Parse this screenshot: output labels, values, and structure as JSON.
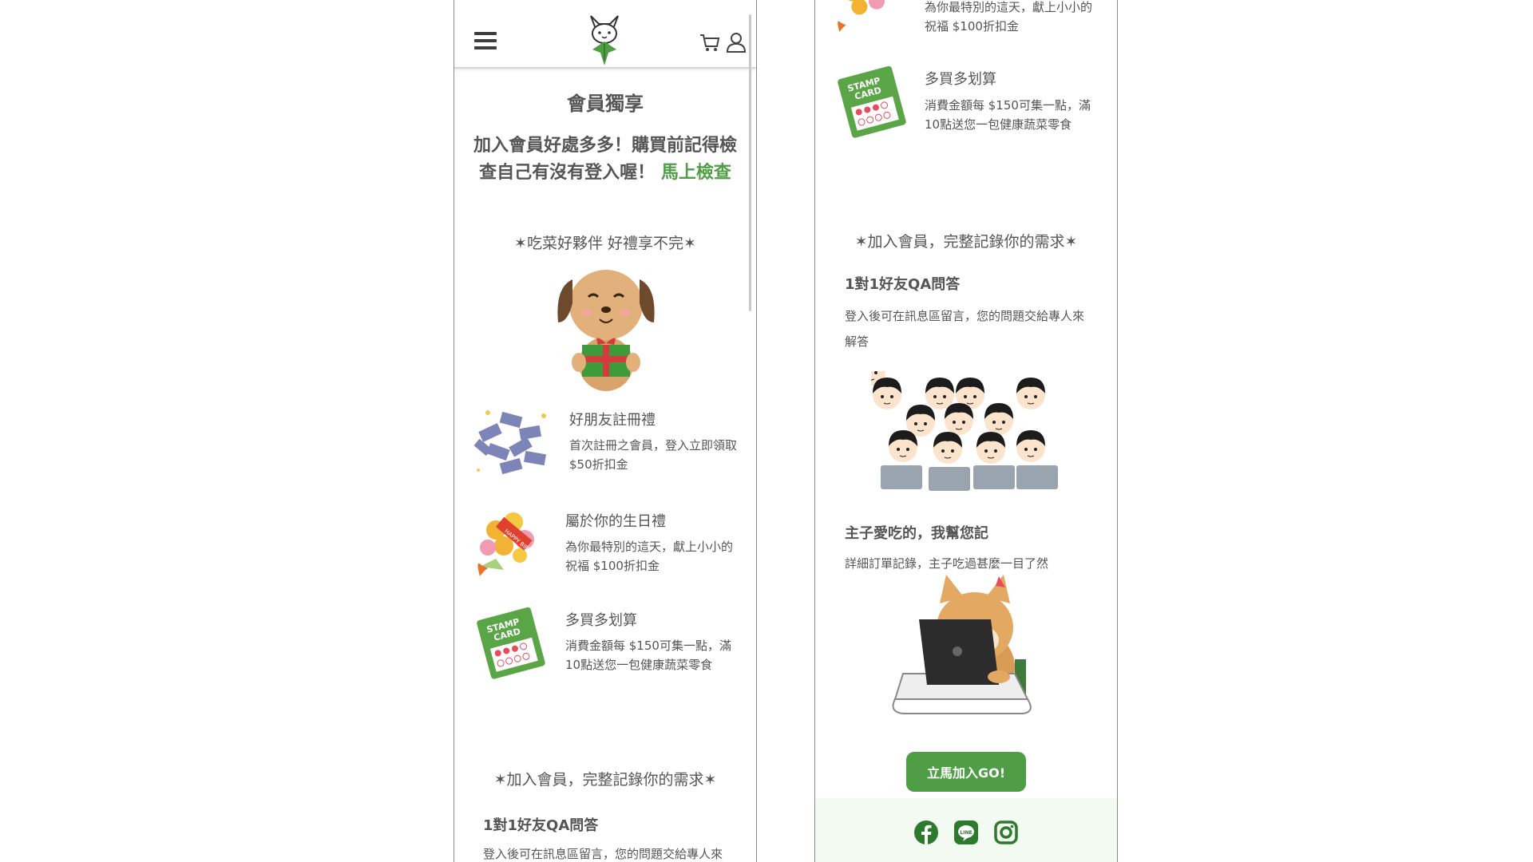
{
  "colors": {
    "accent": "#4f9d45",
    "text": "#555555",
    "footer_bg": "#f3faf1"
  },
  "icons": {
    "menu": "hamburger-icon",
    "cart": "cart-icon",
    "user": "user-icon",
    "logo": "cat-logo",
    "facebook": "facebook-icon",
    "line": "line-icon",
    "instagram": "instagram-icon"
  },
  "page": {
    "title": "會員獨享",
    "intro_text": "加入會員好處多多！購買前記得檢查自己有沒有登入喔！",
    "intro_link": "馬上檢查",
    "perks_heading": "✶吃菜好夥伴 好禮享不完✶",
    "perks": [
      {
        "title": "好朋友註冊禮",
        "desc": "首次註冊之會員，登入立即領取 $50折扣金",
        "icon": "coupons-icon"
      },
      {
        "title": "屬於你的生日禮",
        "desc": "為你最特別的這天，獻上小小的祝福 $100折扣金",
        "icon": "birthday-bouquet-icon"
      },
      {
        "title": "多買多划算",
        "desc": "消費金額每 $150可集一點，滿10點送您一包健康蔬菜零食",
        "icon": "stamp-card-icon"
      }
    ],
    "stamp_card_text": [
      "STAMP",
      "CARD"
    ],
    "birthday_text": "HAPPY BIRTHDAY",
    "records_heading": "✶加入會員，完整記錄你的需求✶",
    "qa": {
      "title": "1對1好友QA問答",
      "desc": "登入後可在訊息區留言，您的問題交給專人來解答"
    },
    "order": {
      "title": "主子愛吃的，我幫您記",
      "desc": "詳細訂單記錄，主子吃過甚麼一目了然"
    },
    "join_button": "立馬加入GO!"
  }
}
